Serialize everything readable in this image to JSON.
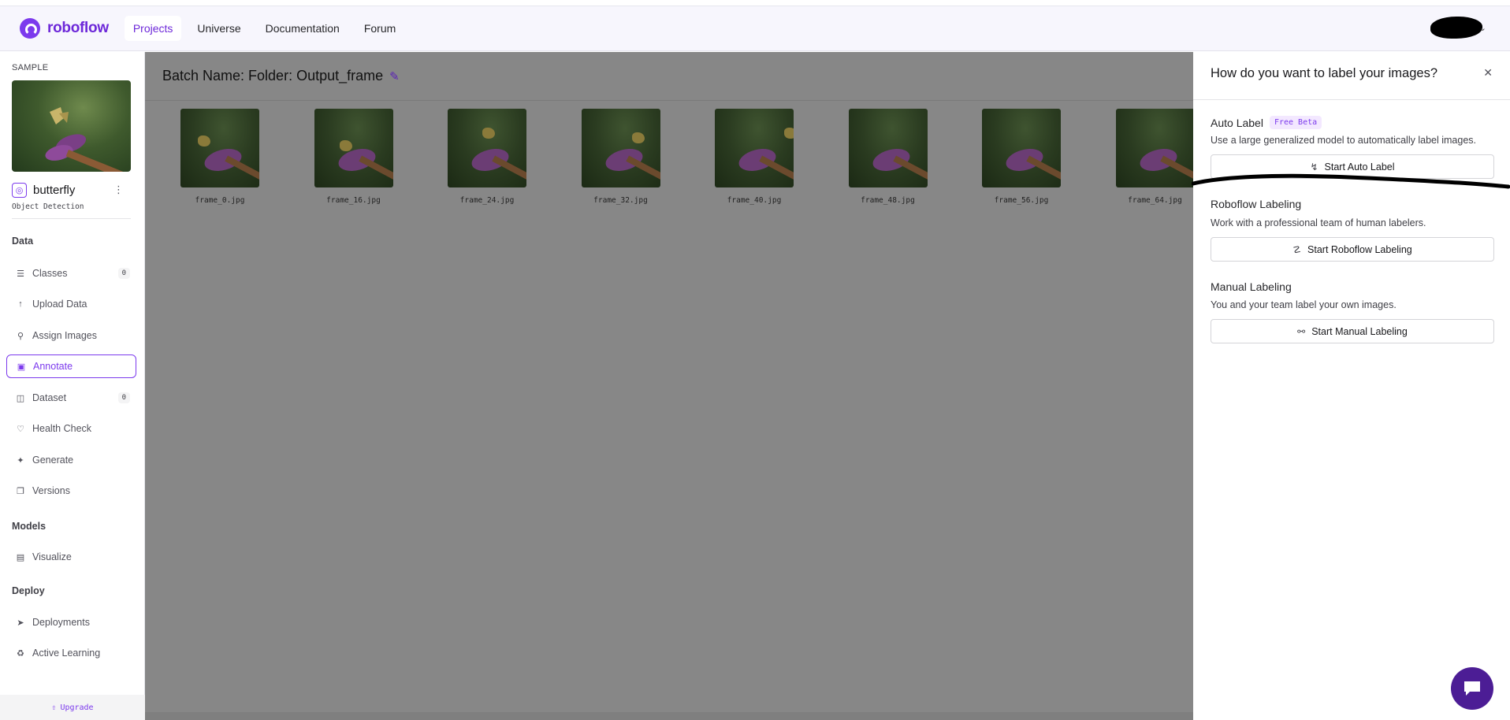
{
  "nav": {
    "brand": "roboflow",
    "links": [
      "Projects",
      "Universe",
      "Documentation",
      "Forum"
    ],
    "active": "Projects"
  },
  "sidebar": {
    "sample_label": "SAMPLE",
    "project_name": "butterfly",
    "project_type": "Object Detection",
    "sections": {
      "data": "Data",
      "models": "Models",
      "deploy": "Deploy"
    },
    "items": [
      {
        "label": "Classes",
        "icon": "list-icon",
        "count": "0"
      },
      {
        "label": "Upload Data",
        "icon": "upload-icon"
      },
      {
        "label": "Assign Images",
        "icon": "search-icon"
      },
      {
        "label": "Annotate",
        "icon": "annotate-icon",
        "active": true
      },
      {
        "label": "Dataset",
        "icon": "dataset-icon",
        "count": "0"
      },
      {
        "label": "Health Check",
        "icon": "heart-pulse-icon"
      },
      {
        "label": "Generate",
        "icon": "generate-icon"
      },
      {
        "label": "Versions",
        "icon": "versions-icon"
      },
      {
        "label": "Visualize",
        "icon": "chart-icon"
      },
      {
        "label": "Deployments",
        "icon": "rocket-icon"
      },
      {
        "label": "Active Learning",
        "icon": "recycle-icon"
      }
    ],
    "upgrade": "Upgrade"
  },
  "main": {
    "batch_title": "Batch Name: Folder: Output_frame",
    "images": [
      "frame_0.jpg",
      "frame_16.jpg",
      "frame_24.jpg",
      "frame_32.jpg",
      "frame_40.jpg",
      "frame_48.jpg",
      "frame_56.jpg",
      "frame_64.jpg"
    ]
  },
  "panel": {
    "title": "How do you want to label your images?",
    "options": {
      "auto": {
        "title": "Auto Label",
        "badge": "Free Beta",
        "desc": "Use a large generalized model to automatically label images.",
        "button": "Start Auto Label"
      },
      "roboflow": {
        "title": "Roboflow Labeling",
        "desc": "Work with a professional team of human labelers.",
        "button": "Start Roboflow Labeling"
      },
      "manual": {
        "title": "Manual Labeling",
        "desc": "You and your team label your own images.",
        "button": "Start Manual Labeling"
      }
    }
  },
  "colors": {
    "accent": "#7c3aed",
    "overlay": "#878787"
  }
}
